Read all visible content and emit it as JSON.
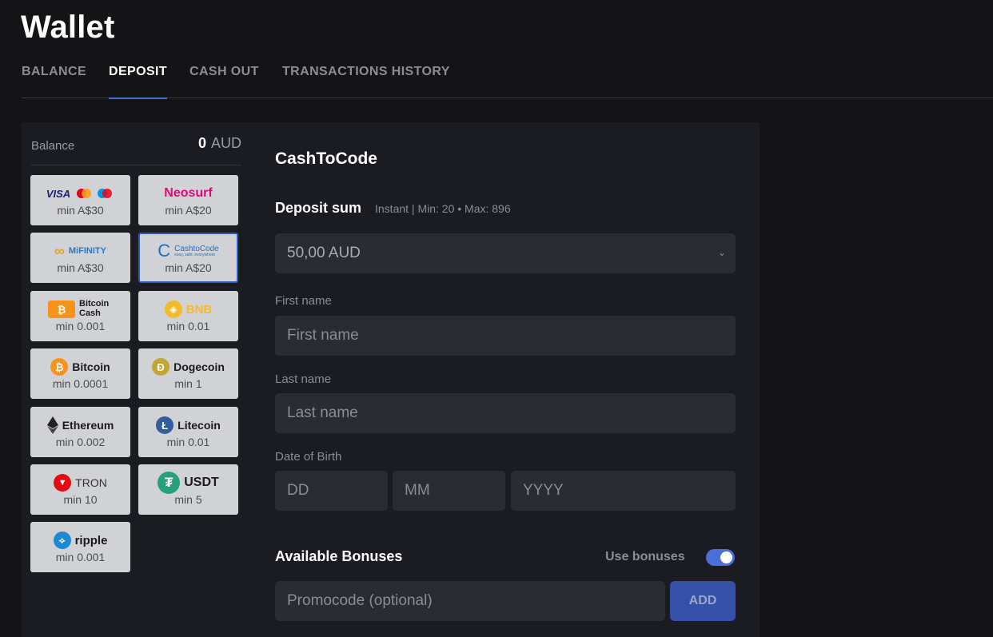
{
  "page": {
    "title": "Wallet"
  },
  "tabs": [
    "BALANCE",
    "DEPOSIT",
    "CASH OUT",
    "TRANSACTIONS HISTORY"
  ],
  "balance": {
    "label": "Balance",
    "amount": "0",
    "currency": "AUD"
  },
  "methods": [
    {
      "name": "VISA",
      "min": "min A$30"
    },
    {
      "name": "Neosurf",
      "min": "min A$20"
    },
    {
      "name": "MiFINITY",
      "min": "min A$30"
    },
    {
      "name": "CashtoCode",
      "tagline": "easy, safe, everywhere",
      "min": "min A$20"
    },
    {
      "name": "Bitcoin Cash",
      "min": "min 0.001"
    },
    {
      "name": "BNB",
      "min": "min 0.01"
    },
    {
      "name": "Bitcoin",
      "min": "min 0.0001"
    },
    {
      "name": "Dogecoin",
      "min": "min 1"
    },
    {
      "name": "Ethereum",
      "min": "min 0.002"
    },
    {
      "name": "Litecoin",
      "min": "min 0.01"
    },
    {
      "name": "TRON",
      "min": "min 10"
    },
    {
      "name": "USDT",
      "min": "min 5"
    },
    {
      "name": "ripple",
      "min": "min 0.001"
    }
  ],
  "form": {
    "title": "CashToCode",
    "sum_label": "Deposit sum",
    "sum_info": "Instant | Min: 20 • Max: 896",
    "amount": "50,00 AUD",
    "first_name_label": "First name",
    "first_name_placeholder": "First name",
    "last_name_label": "Last name",
    "last_name_placeholder": "Last name",
    "dob_label": "Date of Birth",
    "dd": "DD",
    "mm": "MM",
    "yyyy": "YYYY"
  },
  "bonuses": {
    "title": "Available Bonuses",
    "use_label": "Use bonuses",
    "enabled": true,
    "promo_placeholder": "Promocode (optional)",
    "add_label": "ADD"
  },
  "colors": {
    "accent": "#4b6fd8",
    "panel": "#1b1c21",
    "field": "#2a2b33",
    "card": "#d1d2d6"
  }
}
